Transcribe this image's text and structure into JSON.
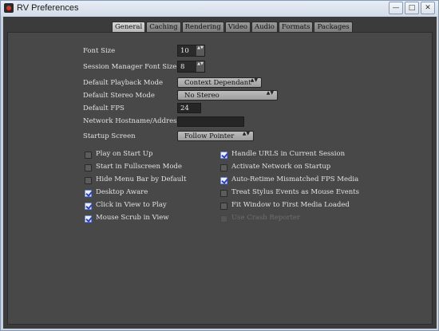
{
  "window": {
    "title": "RV Preferences",
    "buttons": {
      "minimize": "—",
      "maximize": "□",
      "close": "✕"
    }
  },
  "tabs": [
    "General",
    "Caching",
    "Rendering",
    "Video",
    "Audio",
    "Formats",
    "Packages"
  ],
  "active_tab": "General",
  "settings": {
    "font_size": {
      "label": "Font Size",
      "value": "10"
    },
    "session_font_size": {
      "label": "Session Manager Font Size",
      "value": "8"
    },
    "default_playback_mode": {
      "label": "Default Playback Mode",
      "value": "Context Dependant"
    },
    "default_stereo_mode": {
      "label": "Default Stereo Mode",
      "value": "No Stereo"
    },
    "default_fps": {
      "label": "Default FPS",
      "value": "24"
    },
    "network_hostname": {
      "label": "Network Hostname/Address",
      "value": ""
    },
    "startup_screen": {
      "label": "Startup Screen",
      "value": "Follow Pointer"
    }
  },
  "checkboxes_left": [
    {
      "label": "Play on Start Up",
      "checked": false
    },
    {
      "label": "Start in Fullscreen Mode",
      "checked": false
    },
    {
      "label": "Hide Menu Bar by Default",
      "checked": false
    },
    {
      "label": "Desktop Aware",
      "checked": true
    },
    {
      "label": "Click in View to Play",
      "checked": true
    },
    {
      "label": "Mouse Scrub in View",
      "checked": true
    }
  ],
  "checkboxes_right": [
    {
      "label": "Handle URLS in Current Session",
      "checked": true
    },
    {
      "label": "Activate Network on Startup",
      "checked": false
    },
    {
      "label": "Auto-Retime Mismatched FPS Media",
      "checked": true
    },
    {
      "label": "Treat Stylus Events as Mouse Events",
      "checked": false
    },
    {
      "label": "Fit Window to First Media Loaded",
      "checked": false
    },
    {
      "label": "Use Crash Reporter",
      "checked": false,
      "disabled": true
    }
  ],
  "icons": {
    "spin_arrows": "▲▼",
    "combo_arrows": "▲▼"
  }
}
